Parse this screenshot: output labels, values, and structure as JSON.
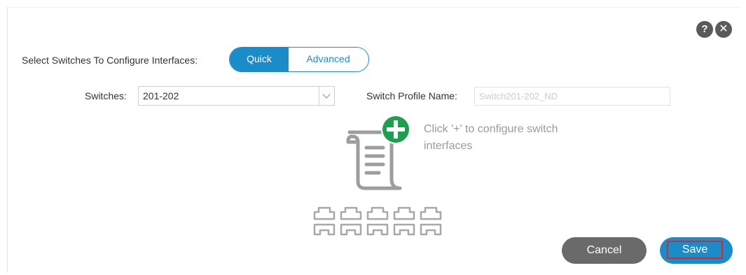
{
  "header": {
    "help_glyph": "?",
    "close_glyph": "✕"
  },
  "configure": {
    "label": "Select Switches To Configure Interfaces:",
    "modes": [
      {
        "label": "Quick",
        "selected": true
      },
      {
        "label": "Advanced",
        "selected": false
      }
    ]
  },
  "switches": {
    "label": "Switches:",
    "value": "201-202"
  },
  "profile": {
    "label": "Switch Profile Name:",
    "placeholder": "Switch201-202_ND"
  },
  "empty_state": {
    "hint": "Click '+' to configure switch interfaces"
  },
  "footer": {
    "cancel_label": "Cancel",
    "save_label": "Save"
  },
  "colors": {
    "accent": "#1a8cc7",
    "cancel": "#6a6a6a",
    "add": "#1e9e4e",
    "highlight": "#d9262f"
  }
}
